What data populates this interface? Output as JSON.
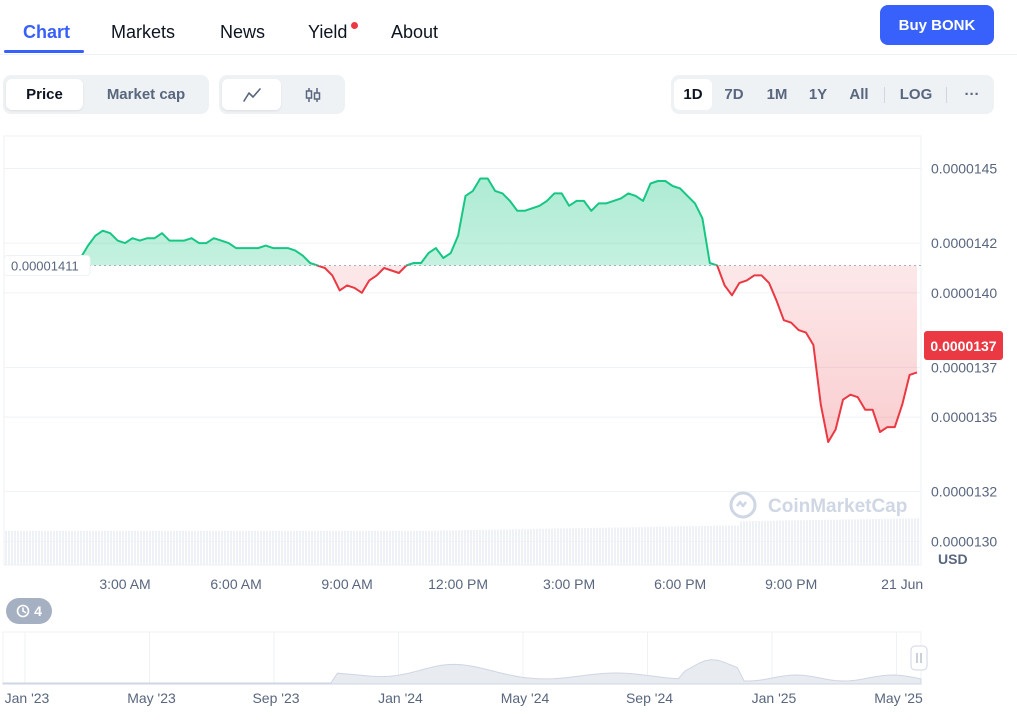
{
  "nav": {
    "tabs": [
      {
        "label": "Chart",
        "active": true
      },
      {
        "label": "Markets"
      },
      {
        "label": "News"
      },
      {
        "label": "Yield",
        "has_dot": true
      },
      {
        "label": "About"
      }
    ],
    "buy_label": "Buy BONK"
  },
  "toolbar": {
    "metric": [
      "Price",
      "Market cap"
    ],
    "ranges": [
      "1D",
      "7D",
      "1M",
      "1Y",
      "All"
    ],
    "log_label": "LOG",
    "more_label": "···",
    "chart_type_icons": [
      "line-chart-icon",
      "candlestick-icon"
    ]
  },
  "chart_data": {
    "type": "line",
    "title": "",
    "x_ticks": [
      "3:00 AM",
      "6:00 AM",
      "9:00 AM",
      "12:00 PM",
      "3:00 PM",
      "6:00 PM",
      "9:00 PM",
      "21 Jun"
    ],
    "y_ticks": [
      "0.0000145",
      "0.0000142",
      "0.0000140",
      "0.0000137",
      "0.0000135",
      "0.0000132",
      "0.0000130"
    ],
    "y_unit": "USD",
    "ylim": [
      1.2905e-05,
      1.4631e-05
    ],
    "baseline_value": 1.411e-05,
    "baseline_label": "0.00001411",
    "current_price_label": "0.0000137",
    "colors": {
      "up": "#16c784",
      "down": "#ea3943"
    },
    "series": [
      {
        "hours": [
          0.0,
          0.2,
          0.4,
          0.6,
          0.8,
          1.0,
          1.2,
          1.4,
          1.6,
          1.8,
          2.0,
          2.2,
          2.4,
          2.6,
          2.8,
          3.0,
          3.2,
          3.4,
          3.6,
          3.8,
          4.0,
          4.2,
          4.4,
          4.6,
          4.8,
          5.0,
          5.2,
          5.4,
          5.6,
          5.8,
          6.0,
          6.2,
          6.4,
          6.6,
          6.8,
          7.0,
          7.2,
          7.4,
          7.6,
          7.8,
          8.0,
          8.2,
          8.4,
          8.6,
          8.8,
          9.0,
          9.2,
          9.4,
          9.6,
          9.8,
          10.0,
          10.2,
          10.4,
          10.6,
          10.8,
          11.0,
          11.2,
          11.4,
          11.6,
          11.8,
          12.0,
          12.2,
          12.4,
          12.6,
          12.8,
          13.0,
          13.2,
          13.4,
          13.6,
          13.8,
          14.0,
          14.2,
          14.4,
          14.6,
          14.8,
          15.0,
          15.2,
          15.4,
          15.6,
          15.8,
          16.0,
          16.2,
          16.4,
          16.6,
          16.8,
          17.0,
          17.2,
          17.4,
          17.6,
          17.8,
          18.0,
          18.2,
          18.4,
          18.6,
          18.8,
          19.0,
          19.2,
          19.4,
          19.6,
          19.8,
          20.0,
          20.2,
          20.4,
          20.6,
          20.8,
          21.0,
          21.2,
          21.4,
          21.6,
          21.8,
          22.0,
          22.2,
          22.4,
          22.6,
          22.8,
          23.0,
          23.2,
          23.4,
          23.6,
          23.8,
          24.0,
          24.2,
          24.4
        ],
        "values": [
          1.415e-05,
          1.412e-05,
          1.412e-05,
          1.412e-05,
          1.413e-05,
          1.412e-05,
          1.412e-05,
          1.412e-05,
          1.413e-05,
          1.414e-05,
          1.419e-05,
          1.423e-05,
          1.425e-05,
          1.424e-05,
          1.421e-05,
          1.42e-05,
          1.422e-05,
          1.421e-05,
          1.422e-05,
          1.422e-05,
          1.424e-05,
          1.421e-05,
          1.421e-05,
          1.421e-05,
          1.422e-05,
          1.42e-05,
          1.42e-05,
          1.422e-05,
          1.421e-05,
          1.42e-05,
          1.418e-05,
          1.418e-05,
          1.418e-05,
          1.418e-05,
          1.419e-05,
          1.418e-05,
          1.418e-05,
          1.418e-05,
          1.417e-05,
          1.415e-05,
          1.412e-05,
          1.411e-05,
          1.41e-05,
          1.407e-05,
          1.401e-05,
          1.403e-05,
          1.402e-05,
          1.4e-05,
          1.405e-05,
          1.407e-05,
          1.41e-05,
          1.409e-05,
          1.408e-05,
          1.411e-05,
          1.412e-05,
          1.412e-05,
          1.416e-05,
          1.418e-05,
          1.414e-05,
          1.416e-05,
          1.423e-05,
          1.439e-05,
          1.441e-05,
          1.446e-05,
          1.446e-05,
          1.441e-05,
          1.44e-05,
          1.437e-05,
          1.433e-05,
          1.433e-05,
          1.434e-05,
          1.435e-05,
          1.437e-05,
          1.44e-05,
          1.44e-05,
          1.435e-05,
          1.437e-05,
          1.437e-05,
          1.433e-05,
          1.436e-05,
          1.436e-05,
          1.437e-05,
          1.438e-05,
          1.44e-05,
          1.439e-05,
          1.437e-05,
          1.444e-05,
          1.445e-05,
          1.445e-05,
          1.443e-05,
          1.442e-05,
          1.439e-05,
          1.436e-05,
          1.43e-05,
          1.412e-05,
          1.411e-05,
          1.403e-05,
          1.399e-05,
          1.404e-05,
          1.405e-05,
          1.407e-05,
          1.407e-05,
          1.404e-05,
          1.397e-05,
          1.389e-05,
          1.388e-05,
          1.385e-05,
          1.384e-05,
          1.379e-05,
          1.355e-05,
          1.34e-05,
          1.345e-05,
          1.357e-05,
          1.359e-05,
          1.358e-05,
          1.353e-05,
          1.353e-05,
          1.344e-05,
          1.346e-05,
          1.346e-05,
          1.355e-05,
          1.367e-05,
          1.368e-05,
          1.37e-05
        ]
      }
    ]
  },
  "watermark": "CoinMarketCap",
  "overview": {
    "x_ticks": [
      "Jan '23",
      "May '23",
      "Sep '23",
      "Jan '24",
      "May '24",
      "Sep '24",
      "Jan '25",
      "May '25"
    ],
    "history_count": "4"
  }
}
